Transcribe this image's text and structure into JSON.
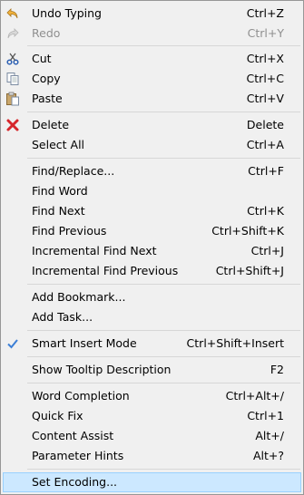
{
  "menu": {
    "items": [
      {
        "label": "Undo Typing",
        "shortcut": "Ctrl+Z"
      },
      {
        "label": "Redo",
        "shortcut": "Ctrl+Y"
      },
      {
        "label": "Cut",
        "shortcut": "Ctrl+X"
      },
      {
        "label": "Copy",
        "shortcut": "Ctrl+C"
      },
      {
        "label": "Paste",
        "shortcut": "Ctrl+V"
      },
      {
        "label": "Delete",
        "shortcut": "Delete"
      },
      {
        "label": "Select All",
        "shortcut": "Ctrl+A"
      },
      {
        "label": "Find/Replace...",
        "shortcut": "Ctrl+F"
      },
      {
        "label": "Find Word",
        "shortcut": ""
      },
      {
        "label": "Find Next",
        "shortcut": "Ctrl+K"
      },
      {
        "label": "Find Previous",
        "shortcut": "Ctrl+Shift+K"
      },
      {
        "label": "Incremental Find Next",
        "shortcut": "Ctrl+J"
      },
      {
        "label": "Incremental Find Previous",
        "shortcut": "Ctrl+Shift+J"
      },
      {
        "label": "Add Bookmark...",
        "shortcut": ""
      },
      {
        "label": "Add Task...",
        "shortcut": ""
      },
      {
        "label": "Smart Insert Mode",
        "shortcut": "Ctrl+Shift+Insert"
      },
      {
        "label": "Show Tooltip Description",
        "shortcut": "F2"
      },
      {
        "label": "Word Completion",
        "shortcut": "Ctrl+Alt+/"
      },
      {
        "label": "Quick Fix",
        "shortcut": "Ctrl+1"
      },
      {
        "label": "Content Assist",
        "shortcut": "Alt+/"
      },
      {
        "label": "Parameter Hints",
        "shortcut": "Alt+?"
      },
      {
        "label": "Set Encoding...",
        "shortcut": ""
      }
    ]
  }
}
